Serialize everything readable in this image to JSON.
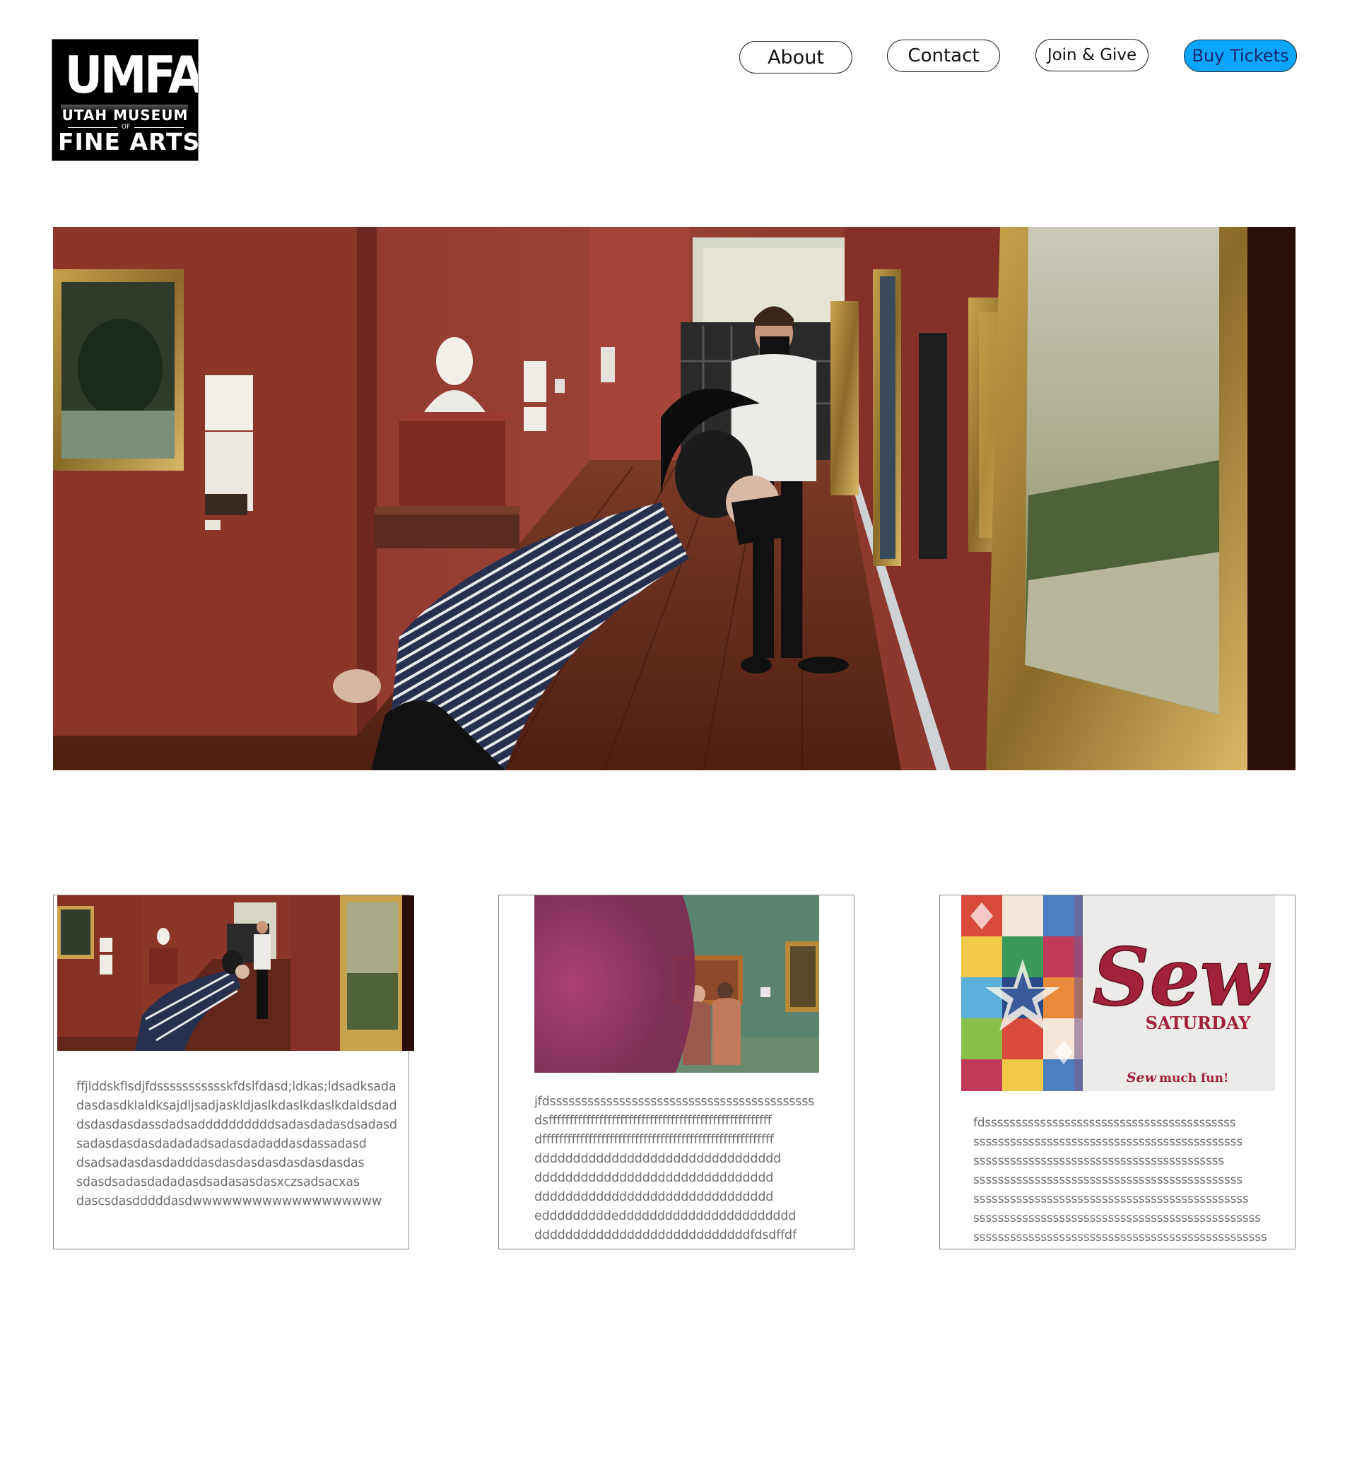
{
  "logo": {
    "main": "UMFA",
    "line1": "UTAH MUSEUM",
    "of": "OF",
    "line2": "FINE ARTS"
  },
  "nav": {
    "about": "About",
    "contact": "Contact",
    "join": "Join & Give",
    "buy": "Buy Tickets"
  },
  "colors": {
    "buy_button_bg": "#0aa5ff",
    "gallery_wall": "#8f3a30"
  },
  "hero": {
    "image": "museum gallery with visitors looking at framed paintings"
  },
  "cards": [
    {
      "image": "museum gallery with visitors looking at framed paintings",
      "text": "ffjlddskflsdjfdssssssssssskfdslfdasd;ldkas;ldsadksada\ndasdasdklaldksajdljsadjaskldjaslkdaslkdaslkdaldsdad\ndsdasdasdassdadsaddddddddddsadasdadasdsadasd\nsadasdasdasdadadadsadasdadaddasdassadasd\ndsadsadasdasdadddasdasdasdasdasdasdasdas\nsdasdsadasdadadasdsadasasdasxczsadsacxas\ndascsdasdddddasdwwwwwwwwwwwwwwwwwww"
    },
    {
      "image": "visitors viewing paintings on a green gallery wall",
      "text": "jfdssssssssssssssssssssssssssssssssssssssssss\ndsfffffffffffffffffffffffffffffffffffffffffffffffffffff\ndfffffffffffffffffffffffffffffffffffffffffffffffffffffff\ndddddddddddddddddddddddddddddddd\nddddddddddddddddddddddddddddddd\nddddddddddddddddddddddddddddddd\nedddddddddeddddddddddddddddddddddd\nddddddddddddddddddddddddddddfdsdffdf"
    },
    {
      "image": "quilt and Sew Saturday banner",
      "banner_title": "Sew",
      "banner_sub": "SATURDAY",
      "banner_tag_a": "Sew",
      "banner_tag_b": "much fun!",
      "text": "fdsssssssssssssssssssssssssssssssssssssssss\nssssssssssssssssssssssssssssssssssssssssssss\nsssssssssssssssssssssssssssssssssssssssss\nssssssssssssssssssssssssssssssssssssssssssss\nsssssssssssssssssssssssssssssssssssssssssssss\nsssssssssssssssssssssssssssssssssssssssssssssss\nssssssssssssssssssssssssssssssssssssssssssssssss"
    }
  ]
}
